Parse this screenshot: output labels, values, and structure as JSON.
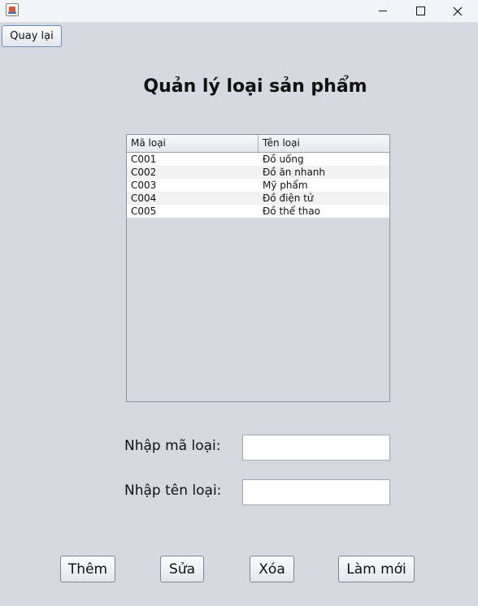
{
  "window": {
    "icons": {
      "app": "java-icon",
      "minimize": "minimize-icon",
      "maximize": "maximize-icon",
      "close": "close-icon"
    }
  },
  "toolbar": {
    "back_label": "Quay lại"
  },
  "header": {
    "title": "Quản lý loại sản phẩm"
  },
  "table": {
    "columns": [
      "Mã loại",
      "Tên loại"
    ],
    "rows": [
      [
        "C001",
        "Đồ uống"
      ],
      [
        "C002",
        "Đồ ăn nhanh"
      ],
      [
        "C003",
        "Mỹ phẩm"
      ],
      [
        "C004",
        "Đồ điện tử"
      ],
      [
        "C005",
        "Đồ thể thao"
      ]
    ]
  },
  "form": {
    "code_label": "Nhập mã loại:",
    "code_value": "",
    "name_label": "Nhập tên loại:",
    "name_value": ""
  },
  "actions": {
    "add": "Thêm",
    "edit": "Sửa",
    "delete": "Xóa",
    "refresh": "Làm mới"
  }
}
